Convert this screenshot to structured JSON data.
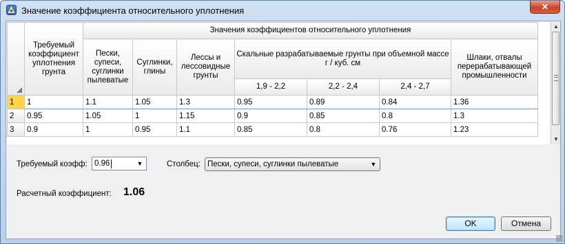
{
  "window": {
    "title": "Значение коэффициента относительного уплотнения",
    "close_label": "✕"
  },
  "table": {
    "header_required": "Требуемый коэффициент уплотнения грунта",
    "header_group": "Значения коэффициентов относительного уплотнения",
    "col_sand": "Пески, супеси, суглинки пылеватые",
    "col_loam": "Суглинки, глины",
    "col_loess": "Лессы и лессовидные грунты",
    "col_rock": "Скальные разрабатываемые грунты при объемной массе г / куб. см",
    "col_slag": "Шлаки, отвалы перерабатывающей промышленности",
    "rock_sub": [
      "1,9 - 2,2",
      "2,2 - 2,4",
      "2,4 - 2,7"
    ],
    "rows": [
      {
        "num": "1",
        "cells": [
          "1",
          "1.1",
          "1.05",
          "1.3",
          "0.95",
          "0.89",
          "0.84",
          "1.36"
        ]
      },
      {
        "num": "2",
        "cells": [
          "0.95",
          "1.05",
          "1",
          "1.15",
          "0.9",
          "0.85",
          "0.8",
          "1.3"
        ]
      },
      {
        "num": "3",
        "cells": [
          "0.9",
          "1",
          "0.95",
          "1.1",
          "0.85",
          "0.8",
          "0.76",
          "1.23"
        ]
      }
    ],
    "selected_row": 1
  },
  "form": {
    "required_label": "Требуемый коэфф:",
    "required_value": "0.96",
    "column_label": "Столбец:",
    "column_value": "Пески, супеси, суглинки пылеватые",
    "result_label": "Расчетный коэффициент:",
    "result_value": "1.06"
  },
  "buttons": {
    "ok": "OK",
    "cancel": "Отмена"
  },
  "icons": {
    "app": "app-icon",
    "dropdown": "chevron-down-icon",
    "scroll_up": "arrow-up-icon",
    "scroll_down": "arrow-down-icon"
  }
}
